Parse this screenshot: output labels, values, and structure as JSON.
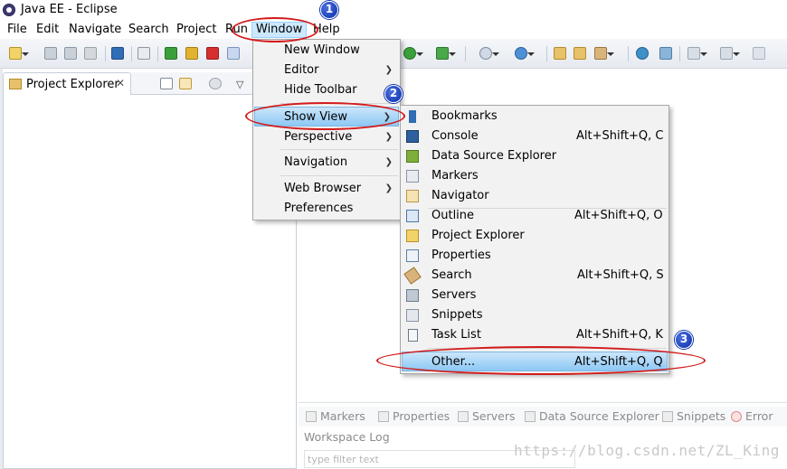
{
  "window": {
    "title": "Java EE - Eclipse"
  },
  "menubar": {
    "items": [
      "File",
      "Edit",
      "Navigate",
      "Search",
      "Project",
      "Run",
      "Window",
      "Help"
    ]
  },
  "project_explorer": {
    "tab_label": "Project Explorer",
    "close_glyph": "✕"
  },
  "window_menu": {
    "items": [
      {
        "label": "New Window",
        "submenu": false
      },
      {
        "label": "Editor",
        "submenu": true
      },
      {
        "label": "Hide Toolbar",
        "submenu": false
      },
      {
        "label": "Show View",
        "submenu": true,
        "highlighted": true
      },
      {
        "label": "Perspective",
        "submenu": true
      },
      {
        "label": "Navigation",
        "submenu": true
      },
      {
        "label": "Web Browser",
        "submenu": true
      },
      {
        "label": "Preferences",
        "submenu": false
      }
    ]
  },
  "show_view_menu": {
    "items": [
      {
        "label": "Bookmarks",
        "shortcut": "",
        "icon": "bookmark-icon"
      },
      {
        "label": "Console",
        "shortcut": "Alt+Shift+Q, C",
        "icon": "console-icon"
      },
      {
        "label": "Data Source Explorer",
        "shortcut": "",
        "icon": "database-icon"
      },
      {
        "label": "Markers",
        "shortcut": "",
        "icon": "markers-icon"
      },
      {
        "label": "Navigator",
        "shortcut": "",
        "icon": "navigator-icon"
      },
      {
        "label": "Outline",
        "shortcut": "Alt+Shift+Q, O",
        "icon": "outline-icon"
      },
      {
        "label": "Project Explorer",
        "shortcut": "",
        "icon": "folder-icon"
      },
      {
        "label": "Properties",
        "shortcut": "",
        "icon": "properties-icon"
      },
      {
        "label": "Search",
        "shortcut": "Alt+Shift+Q, S",
        "icon": "search-flashlight-icon"
      },
      {
        "label": "Servers",
        "shortcut": "",
        "icon": "servers-icon"
      },
      {
        "label": "Snippets",
        "shortcut": "",
        "icon": "snippets-icon"
      },
      {
        "label": "Task List",
        "shortcut": "Alt+Shift+Q, K",
        "icon": "task-list-icon"
      },
      {
        "label": "Other...",
        "shortcut": "Alt+Shift+Q, Q",
        "icon": "",
        "highlighted": true
      }
    ]
  },
  "bottom_panel": {
    "tabs": [
      "Markers",
      "Properties",
      "Servers",
      "Data Source Explorer",
      "Snippets",
      "Error"
    ],
    "workspace_log": "Workspace Log",
    "filter_placeholder": "type filter text"
  },
  "annotations": {
    "badges": [
      "1",
      "2",
      "3"
    ],
    "accent": "#d21b1b",
    "badge_color": "#0a2fa8"
  },
  "watermark": "https://blog.csdn.net/ZL_King"
}
